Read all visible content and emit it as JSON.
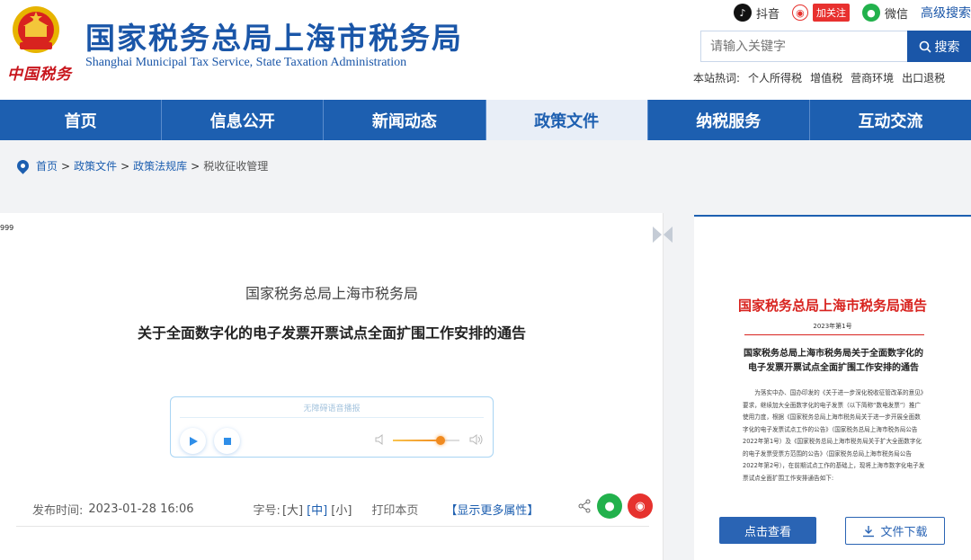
{
  "header": {
    "seal_text": "中国税务",
    "title": "国家税务总局上海市税务局",
    "subtitle": "Shanghai Municipal Tax Service, State Taxation Administration",
    "social": {
      "douyin": "抖音",
      "weibo_badge": "加关注",
      "wechat": "微信",
      "advanced_search": "高级搜索"
    },
    "search": {
      "placeholder": "请输入关键字",
      "button": "搜索"
    },
    "hotwords": {
      "label": "本站热词:",
      "items": [
        "个人所得税",
        "增值税",
        "营商环境",
        "出口退税"
      ]
    }
  },
  "nav": {
    "items": [
      "首页",
      "信息公开",
      "新闻动态",
      "政策文件",
      "纳税服务",
      "互动交流"
    ],
    "active_index": 3
  },
  "breadcrumb": {
    "items": [
      "首页",
      "政策文件",
      "政策法规库",
      "税收征收管理"
    ],
    "separator": ">"
  },
  "article": {
    "tiny_mark": "999",
    "issuer": "国家税务总局上海市税务局",
    "title": "关于全面数字化的电子发票开票试点全面扩围工作安排的通告",
    "player": {
      "label": "无障碍语音播报",
      "volume": 0.72
    },
    "meta": {
      "publish_label": "发布时间:",
      "publish_date": "2023-01-28 16:06",
      "font_label": "字号:",
      "font_large": "[大]",
      "font_medium": "[中]",
      "font_small": "[小]",
      "print": "打印本页",
      "more": "【显示更多属性】"
    }
  },
  "notice": {
    "title": "国家税务总局上海市税务局通告",
    "number": "2023年第1号",
    "heading_line1": "国家税务总局上海市税务局关于全面数字化的",
    "heading_line2": "电子发票开票试点全面扩围工作安排的通告",
    "body": "为落实中办、国办印发的《关于进一步深化税收征管改革的意见》要求，继续加大全面数字化的电子发票（以下简称“数电发票”）推广使用力度，根据《国家税务总局上海市税务局关于进一步开展全面数字化的电子发票试点工作的公告》（国家税务总局上海市税务局公告2022年第1号）及《国家税务总局上海市税务局关于扩大全面数字化的电子发票受票方范围的公告》（国家税务总局上海市税务局公告2022年第2号），在前期试点工作的基础上，现将上海市数字化电子发票试点全面扩围工作安排通告如下:",
    "view_button": "点击查看",
    "download_button": "文件下载"
  },
  "colors": {
    "brand_blue": "#1d5fb0",
    "notice_red": "#d8231f",
    "wechat_green": "#22b14c",
    "weibo_red": "#e6322e"
  }
}
